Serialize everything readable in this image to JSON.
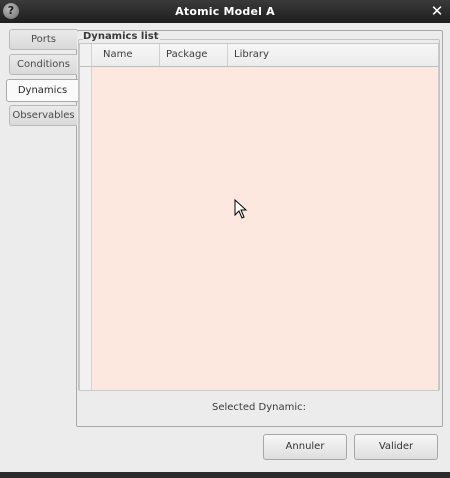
{
  "window": {
    "title": "Atomic Model A",
    "icon_glyph": "?"
  },
  "tabs": [
    {
      "label": "Ports",
      "active": false
    },
    {
      "label": "Conditions",
      "active": false
    },
    {
      "label": "Dynamics",
      "active": true
    },
    {
      "label": "Observables",
      "active": false
    }
  ],
  "dynamics": {
    "group_label": "Dynamics list",
    "columns": [
      "Name",
      "Package",
      "Library"
    ],
    "rows": [],
    "selected_label": "Selected Dynamic:"
  },
  "buttons": {
    "cancel": "Annuler",
    "ok": "Valider"
  },
  "colors": {
    "table_background": "#fde8e0",
    "titlebar": "#2a2a2a"
  }
}
